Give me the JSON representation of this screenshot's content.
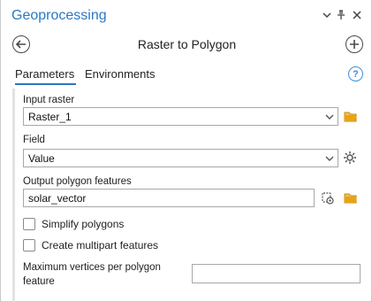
{
  "pane": {
    "title": "Geoprocessing",
    "controls": {
      "dropdown_icon": "chevron-down-icon",
      "pin_icon": "pin-icon",
      "close_icon": "close-icon"
    }
  },
  "header": {
    "tool_name": "Raster to Polygon",
    "back_icon": "back-arrow-icon",
    "add_icon": "add-circle-icon"
  },
  "tabs": [
    {
      "label": "Parameters",
      "active": true
    },
    {
      "label": "Environments",
      "active": false
    }
  ],
  "help_icon": "help-icon",
  "help_glyph": "?",
  "params": {
    "input_raster": {
      "label": "Input raster",
      "value": "Raster_1"
    },
    "field": {
      "label": "Field",
      "value": "Value"
    },
    "output_features": {
      "label": "Output polygon features",
      "value": "solar_vector"
    },
    "simplify": {
      "label": "Simplify polygons",
      "checked": false
    },
    "multipart": {
      "label": "Create multipart features",
      "checked": false
    },
    "max_vertices": {
      "label": "Maximum vertices per polygon feature",
      "value": ""
    }
  },
  "colors": {
    "accent": "#2a78c2",
    "folder": "#e8a317",
    "border": "#a8a8a8"
  }
}
